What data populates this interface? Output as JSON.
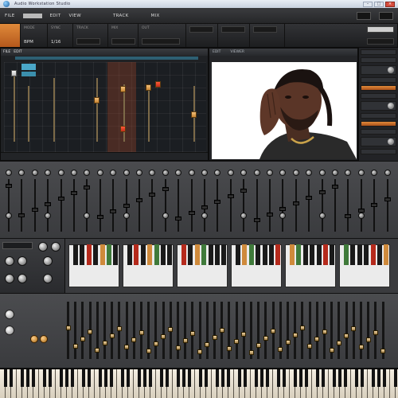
{
  "window": {
    "title": "Audio Workstation Studio"
  },
  "menu": {
    "items": [
      "FILE",
      "EDIT",
      "VIEW",
      "TRACK",
      "MIX"
    ]
  },
  "transport": {
    "cells": [
      {
        "label": "",
        "value": ""
      },
      {
        "label": "MODE",
        "value": "BPM"
      },
      {
        "label": "SYNC",
        "value": "1/16"
      },
      {
        "label": "TRACK",
        "value": "REC"
      },
      {
        "label": "MIX",
        "value": "FX"
      },
      {
        "label": "OUT",
        "value": "VOL"
      }
    ]
  },
  "editor": {
    "tabs": [
      "FILE",
      "EDIT"
    ]
  },
  "video": {
    "header": [
      "EDIT",
      "VIEWER"
    ],
    "caption": ""
  },
  "colors": {
    "accent_orange": "#e08a3a",
    "accent_teal": "#4aa7c8",
    "panel_dark": "#1f2124",
    "panel_mid": "#3a3b3e"
  }
}
